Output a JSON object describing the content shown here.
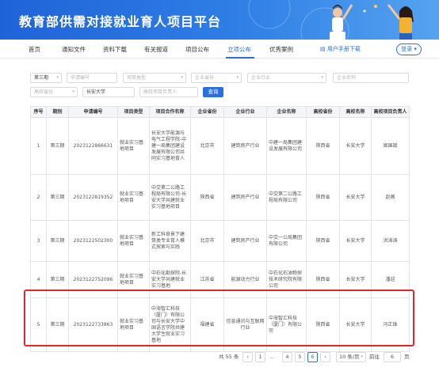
{
  "header": {
    "title": "教育部供需对接就业育人项目平台"
  },
  "nav": {
    "items": [
      "首页",
      "通知文件",
      "资料下载",
      "有关报道",
      "项目公布",
      "立项公布",
      "优秀案例"
    ],
    "active_index": 5,
    "manual": "用户手册下载",
    "login": "登录"
  },
  "filters": {
    "batch": "第三期",
    "apply_no": "申请编号",
    "project_type": "项目类型",
    "company_province": "企业省份",
    "company_industry": "企业行业",
    "company_name": "企业名称",
    "school_province": "高校省份",
    "school_name": "长安大学",
    "school_leader": "高校项目负责人",
    "query": "查询"
  },
  "table": {
    "headers": [
      "序号",
      "期别",
      "申请编号",
      "项目类型",
      "项目合作名称",
      "企业省份",
      "企业行业",
      "企业名称",
      "高校省份",
      "高校名称",
      "高校项目负责人"
    ],
    "rows": [
      [
        "1",
        "第三期",
        "2023122866631",
        "就业实习基地项目",
        "长安大学能源与电气工程学院-中建一局集团建设发展有限公司共同实习基地育人",
        "北京市",
        "建筑房产行业",
        "中建一局集团建设发展有限公司",
        "陕西省",
        "长安大学",
        "姬国斌"
      ],
      [
        "2",
        "第三期",
        "2023122819352",
        "就业实习基地项目",
        "中交第二公路工程局有限公司-长安大学共建就业实习基地项目",
        "陕西省",
        "建筑房产行业",
        "中交第二公路工程局有限公司",
        "陕西省",
        "长安大学",
        "赵薇"
      ],
      [
        "3",
        "第三期",
        "2023122502300",
        "就业实习基地项目",
        "新工科背景下建筑类专业育人模式探索与实践",
        "北京市",
        "建筑房产行业",
        "中交一公局集团有限公司",
        "陕西省",
        "长安大学",
        "洪涛涛"
      ],
      [
        "4",
        "第三期",
        "2023122752096",
        "就业实习基地项目",
        "中石化勘探院-长安大学共建就业实习基地",
        "江苏省",
        "能源动力行业",
        "中石化石油物探技术研究院有限公司",
        "陕西省",
        "长安大学",
        "潘迎"
      ],
      [
        "5",
        "第三期",
        "2023122733863",
        "就业实习基地项目",
        "中海智汇科技（厦门）有限公司与长安大学中国语言学院共建大学生就业实习基地",
        "福建省",
        "信息通讯与互联网行业",
        "中海智汇科技（厦门）有限公司",
        "陕西省",
        "长安大学",
        "冯正珠"
      ]
    ]
  },
  "pagination": {
    "total": "共 55 条",
    "pages": [
      "1",
      "...",
      "4",
      "5",
      "6"
    ],
    "active": "6",
    "page_size": "10 条/页",
    "goto_label": "前往",
    "goto_value": "6",
    "page_unit": "页"
  },
  "colors": {
    "brand": "#2a6fe0",
    "highlight": "#e3262b"
  }
}
